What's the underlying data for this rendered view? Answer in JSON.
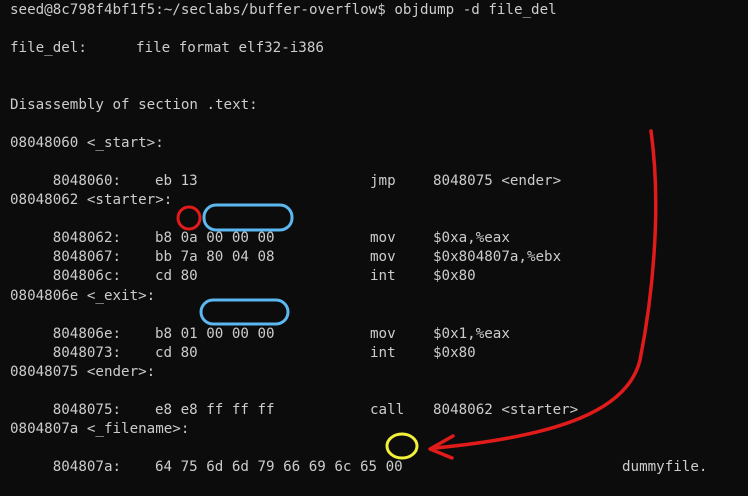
{
  "prompt": {
    "user_host": "seed@8c798f4bf1f5",
    "path": ":~/seclabs/buffer-overflow$",
    "command": " objdump -d file_del"
  },
  "file_header": {
    "name": "file_del:",
    "format": "file format elf32-i386"
  },
  "section_header": "Disassembly of section .text:",
  "blocks": [
    {
      "label": "08048060 <_start>:",
      "rows": [
        {
          "addr": " 8048060:",
          "bytes": "eb 13",
          "mnem": "jmp",
          "ops": "8048075 <ender>"
        }
      ]
    },
    {
      "label": "08048062 <starter>:",
      "rows": [
        {
          "addr": " 8048062:",
          "bytes": "b8 0a 00 00 00",
          "mnem": "mov",
          "ops": "$0xa,%eax"
        },
        {
          "addr": " 8048067:",
          "bytes": "bb 7a 80 04 08",
          "mnem": "mov",
          "ops": "$0x804807a,%ebx"
        },
        {
          "addr": " 804806c:",
          "bytes": "cd 80",
          "mnem": "int",
          "ops": "$0x80"
        }
      ]
    },
    {
      "label": "0804806e <_exit>:",
      "rows": [
        {
          "addr": " 804806e:",
          "bytes": "b8 01 00 00 00",
          "mnem": "mov",
          "ops": "$0x1,%eax"
        },
        {
          "addr": " 8048073:",
          "bytes": "cd 80",
          "mnem": "int",
          "ops": "$0x80"
        }
      ]
    },
    {
      "label": "08048075 <ender>:",
      "rows": [
        {
          "addr": " 8048075:",
          "bytes": "e8 e8 ff ff ff",
          "mnem": "call",
          "ops": "8048062 <starter>"
        }
      ]
    },
    {
      "label": "0804807a <_filename>:",
      "rows": [
        {
          "addr": " 804807a:",
          "bytes": "64 75 6d 6d 79 66 69 6c 65 00",
          "mnem": "",
          "ops": "dummyfile."
        }
      ]
    }
  ],
  "annotation_colors": {
    "red": "#e11a1a",
    "blue": "#5cb8f0",
    "yellow": "#f2f03a"
  },
  "colors": {
    "background": "#0c0c0c",
    "text": "#cccccc"
  }
}
